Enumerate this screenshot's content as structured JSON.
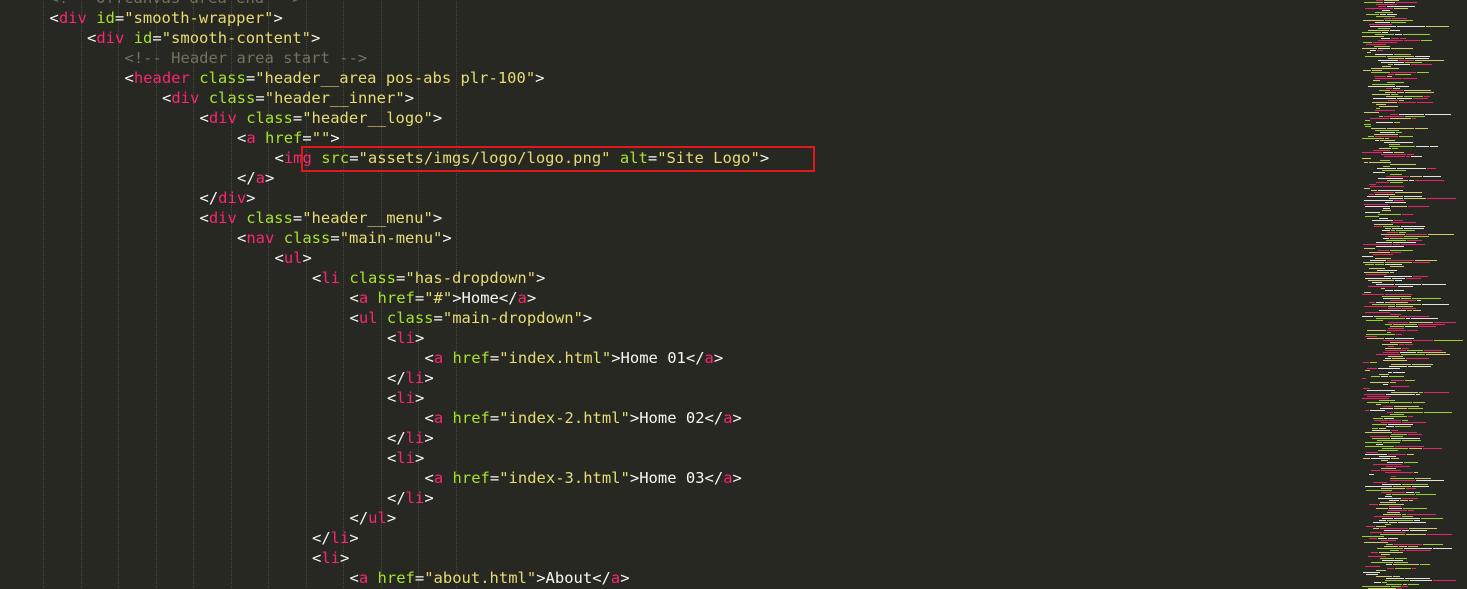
{
  "theme": {
    "background": "#272822",
    "tag_color": "#f92672",
    "attr_color": "#a6e22e",
    "string_color": "#e6db74",
    "comment_color": "#75715e",
    "text_color": "#f8f8f2",
    "highlight_border": "#e0191e"
  },
  "editor": {
    "highlighted_line_index": 8,
    "lines": [
      {
        "indent": 2,
        "tokens": [
          {
            "t": "comment",
            "v": "<!-- Offcanvas area end -->"
          }
        ]
      },
      {
        "indent": 2,
        "tokens": [
          {
            "t": "punct",
            "v": "<"
          },
          {
            "t": "tag",
            "v": "div"
          },
          {
            "t": "text",
            "v": " "
          },
          {
            "t": "attr",
            "v": "id"
          },
          {
            "t": "punct",
            "v": "="
          },
          {
            "t": "str",
            "v": "\"smooth-wrapper\""
          },
          {
            "t": "punct",
            "v": ">"
          }
        ]
      },
      {
        "indent": 3,
        "tokens": [
          {
            "t": "punct",
            "v": "<"
          },
          {
            "t": "tag",
            "v": "div"
          },
          {
            "t": "text",
            "v": " "
          },
          {
            "t": "attr",
            "v": "id"
          },
          {
            "t": "punct",
            "v": "="
          },
          {
            "t": "str",
            "v": "\"smooth-content\""
          },
          {
            "t": "punct",
            "v": ">"
          }
        ]
      },
      {
        "indent": 4,
        "tokens": [
          {
            "t": "comment",
            "v": "<!-- Header area start -->"
          }
        ]
      },
      {
        "indent": 4,
        "tokens": [
          {
            "t": "punct",
            "v": "<"
          },
          {
            "t": "tag",
            "v": "header"
          },
          {
            "t": "text",
            "v": " "
          },
          {
            "t": "attr",
            "v": "class"
          },
          {
            "t": "punct",
            "v": "="
          },
          {
            "t": "str",
            "v": "\"header__area pos-abs plr-100\""
          },
          {
            "t": "punct",
            "v": ">"
          }
        ]
      },
      {
        "indent": 5,
        "tokens": [
          {
            "t": "punct",
            "v": "<"
          },
          {
            "t": "tag",
            "v": "div"
          },
          {
            "t": "text",
            "v": " "
          },
          {
            "t": "attr",
            "v": "class"
          },
          {
            "t": "punct",
            "v": "="
          },
          {
            "t": "str",
            "v": "\"header__inner\""
          },
          {
            "t": "punct",
            "v": ">"
          }
        ]
      },
      {
        "indent": 6,
        "tokens": [
          {
            "t": "punct",
            "v": "<"
          },
          {
            "t": "tag",
            "v": "div"
          },
          {
            "t": "text",
            "v": " "
          },
          {
            "t": "attr",
            "v": "class"
          },
          {
            "t": "punct",
            "v": "="
          },
          {
            "t": "str",
            "v": "\"header__logo\""
          },
          {
            "t": "punct",
            "v": ">"
          }
        ]
      },
      {
        "indent": 7,
        "tokens": [
          {
            "t": "punct",
            "v": "<"
          },
          {
            "t": "tag",
            "v": "a"
          },
          {
            "t": "text",
            "v": " "
          },
          {
            "t": "attr",
            "v": "href"
          },
          {
            "t": "punct",
            "v": "="
          },
          {
            "t": "str",
            "v": "\"\""
          },
          {
            "t": "punct",
            "v": ">"
          }
        ]
      },
      {
        "indent": 8,
        "tokens": [
          {
            "t": "punct",
            "v": "<"
          },
          {
            "t": "tag",
            "v": "img"
          },
          {
            "t": "text",
            "v": " "
          },
          {
            "t": "attr",
            "v": "src"
          },
          {
            "t": "punct",
            "v": "="
          },
          {
            "t": "str",
            "v": "\"assets/imgs/logo/logo.png\""
          },
          {
            "t": "text",
            "v": " "
          },
          {
            "t": "attr",
            "v": "alt"
          },
          {
            "t": "punct",
            "v": "="
          },
          {
            "t": "str",
            "v": "\"Site Logo\""
          },
          {
            "t": "punct",
            "v": ">"
          }
        ]
      },
      {
        "indent": 7,
        "tokens": [
          {
            "t": "punct",
            "v": "</"
          },
          {
            "t": "tag",
            "v": "a"
          },
          {
            "t": "punct",
            "v": ">"
          }
        ]
      },
      {
        "indent": 6,
        "tokens": [
          {
            "t": "punct",
            "v": "</"
          },
          {
            "t": "tag",
            "v": "div"
          },
          {
            "t": "punct",
            "v": ">"
          }
        ]
      },
      {
        "indent": 6,
        "tokens": [
          {
            "t": "punct",
            "v": "<"
          },
          {
            "t": "tag",
            "v": "div"
          },
          {
            "t": "text",
            "v": " "
          },
          {
            "t": "attr",
            "v": "class"
          },
          {
            "t": "punct",
            "v": "="
          },
          {
            "t": "str",
            "v": "\"header__menu\""
          },
          {
            "t": "punct",
            "v": ">"
          }
        ]
      },
      {
        "indent": 7,
        "tokens": [
          {
            "t": "punct",
            "v": "<"
          },
          {
            "t": "tag",
            "v": "nav"
          },
          {
            "t": "text",
            "v": " "
          },
          {
            "t": "attr",
            "v": "class"
          },
          {
            "t": "punct",
            "v": "="
          },
          {
            "t": "str",
            "v": "\"main-menu\""
          },
          {
            "t": "punct",
            "v": ">"
          }
        ]
      },
      {
        "indent": 8,
        "tokens": [
          {
            "t": "punct",
            "v": "<"
          },
          {
            "t": "tag",
            "v": "ul"
          },
          {
            "t": "punct",
            "v": ">"
          }
        ]
      },
      {
        "indent": 9,
        "tokens": [
          {
            "t": "punct",
            "v": "<"
          },
          {
            "t": "tag",
            "v": "li"
          },
          {
            "t": "text",
            "v": " "
          },
          {
            "t": "attr",
            "v": "class"
          },
          {
            "t": "punct",
            "v": "="
          },
          {
            "t": "str",
            "v": "\"has-dropdown\""
          },
          {
            "t": "punct",
            "v": ">"
          }
        ]
      },
      {
        "indent": 10,
        "tokens": [
          {
            "t": "punct",
            "v": "<"
          },
          {
            "t": "tag",
            "v": "a"
          },
          {
            "t": "text",
            "v": " "
          },
          {
            "t": "attr",
            "v": "href"
          },
          {
            "t": "punct",
            "v": "="
          },
          {
            "t": "str",
            "v": "\"#\""
          },
          {
            "t": "punct",
            "v": ">"
          },
          {
            "t": "text",
            "v": "Home"
          },
          {
            "t": "punct",
            "v": "</"
          },
          {
            "t": "tag",
            "v": "a"
          },
          {
            "t": "punct",
            "v": ">"
          }
        ]
      },
      {
        "indent": 10,
        "tokens": [
          {
            "t": "punct",
            "v": "<"
          },
          {
            "t": "tag",
            "v": "ul"
          },
          {
            "t": "text",
            "v": " "
          },
          {
            "t": "attr",
            "v": "class"
          },
          {
            "t": "punct",
            "v": "="
          },
          {
            "t": "str",
            "v": "\"main-dropdown\""
          },
          {
            "t": "punct",
            "v": ">"
          }
        ]
      },
      {
        "indent": 11,
        "tokens": [
          {
            "t": "punct",
            "v": "<"
          },
          {
            "t": "tag",
            "v": "li"
          },
          {
            "t": "punct",
            "v": ">"
          }
        ]
      },
      {
        "indent": 12,
        "tokens": [
          {
            "t": "punct",
            "v": "<"
          },
          {
            "t": "tag",
            "v": "a"
          },
          {
            "t": "text",
            "v": " "
          },
          {
            "t": "attr",
            "v": "href"
          },
          {
            "t": "punct",
            "v": "="
          },
          {
            "t": "str",
            "v": "\"index.html\""
          },
          {
            "t": "punct",
            "v": ">"
          },
          {
            "t": "text",
            "v": "Home 01"
          },
          {
            "t": "punct",
            "v": "</"
          },
          {
            "t": "tag",
            "v": "a"
          },
          {
            "t": "punct",
            "v": ">"
          }
        ]
      },
      {
        "indent": 11,
        "tokens": [
          {
            "t": "punct",
            "v": "</"
          },
          {
            "t": "tag",
            "v": "li"
          },
          {
            "t": "punct",
            "v": ">"
          }
        ]
      },
      {
        "indent": 11,
        "tokens": [
          {
            "t": "punct",
            "v": "<"
          },
          {
            "t": "tag",
            "v": "li"
          },
          {
            "t": "punct",
            "v": ">"
          }
        ]
      },
      {
        "indent": 12,
        "tokens": [
          {
            "t": "punct",
            "v": "<"
          },
          {
            "t": "tag",
            "v": "a"
          },
          {
            "t": "text",
            "v": " "
          },
          {
            "t": "attr",
            "v": "href"
          },
          {
            "t": "punct",
            "v": "="
          },
          {
            "t": "str",
            "v": "\"index-2.html\""
          },
          {
            "t": "punct",
            "v": ">"
          },
          {
            "t": "text",
            "v": "Home 02"
          },
          {
            "t": "punct",
            "v": "</"
          },
          {
            "t": "tag",
            "v": "a"
          },
          {
            "t": "punct",
            "v": ">"
          }
        ]
      },
      {
        "indent": 11,
        "tokens": [
          {
            "t": "punct",
            "v": "</"
          },
          {
            "t": "tag",
            "v": "li"
          },
          {
            "t": "punct",
            "v": ">"
          }
        ]
      },
      {
        "indent": 11,
        "tokens": [
          {
            "t": "punct",
            "v": "<"
          },
          {
            "t": "tag",
            "v": "li"
          },
          {
            "t": "punct",
            "v": ">"
          }
        ]
      },
      {
        "indent": 12,
        "tokens": [
          {
            "t": "punct",
            "v": "<"
          },
          {
            "t": "tag",
            "v": "a"
          },
          {
            "t": "text",
            "v": " "
          },
          {
            "t": "attr",
            "v": "href"
          },
          {
            "t": "punct",
            "v": "="
          },
          {
            "t": "str",
            "v": "\"index-3.html\""
          },
          {
            "t": "punct",
            "v": ">"
          },
          {
            "t": "text",
            "v": "Home 03"
          },
          {
            "t": "punct",
            "v": "</"
          },
          {
            "t": "tag",
            "v": "a"
          },
          {
            "t": "punct",
            "v": ">"
          }
        ]
      },
      {
        "indent": 11,
        "tokens": [
          {
            "t": "punct",
            "v": "</"
          },
          {
            "t": "tag",
            "v": "li"
          },
          {
            "t": "punct",
            "v": ">"
          }
        ]
      },
      {
        "indent": 10,
        "tokens": [
          {
            "t": "punct",
            "v": "</"
          },
          {
            "t": "tag",
            "v": "ul"
          },
          {
            "t": "punct",
            "v": ">"
          }
        ]
      },
      {
        "indent": 9,
        "tokens": [
          {
            "t": "punct",
            "v": "</"
          },
          {
            "t": "tag",
            "v": "li"
          },
          {
            "t": "punct",
            "v": ">"
          }
        ]
      },
      {
        "indent": 9,
        "tokens": [
          {
            "t": "punct",
            "v": "<"
          },
          {
            "t": "tag",
            "v": "li"
          },
          {
            "t": "punct",
            "v": ">"
          }
        ]
      },
      {
        "indent": 10,
        "tokens": [
          {
            "t": "punct",
            "v": "<"
          },
          {
            "t": "tag",
            "v": "a"
          },
          {
            "t": "text",
            "v": " "
          },
          {
            "t": "attr",
            "v": "href"
          },
          {
            "t": "punct",
            "v": "="
          },
          {
            "t": "str",
            "v": "\"about.html\""
          },
          {
            "t": "punct",
            "v": ">"
          },
          {
            "t": "text",
            "v": "About"
          },
          {
            "t": "punct",
            "v": "</"
          },
          {
            "t": "tag",
            "v": "a"
          },
          {
            "t": "punct",
            "v": ">"
          }
        ]
      }
    ]
  }
}
